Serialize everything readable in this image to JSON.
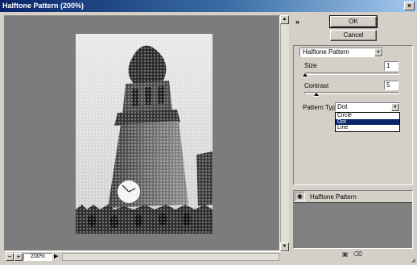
{
  "window": {
    "title": "Halftone Pattern (200%)",
    "close_glyph": "×"
  },
  "preview": {
    "zoom_out": "−",
    "zoom_in": "+",
    "zoom_level": "200%",
    "zoom_menu_glyph": "▶"
  },
  "dialog": {
    "collapse_glyph": "»",
    "ok_label": "OK",
    "cancel_label": "Cancel"
  },
  "settings": {
    "filter_name": "Halftone Pattern",
    "size_label": "Size",
    "size_value": "1",
    "size_level": 0.0,
    "contrast_label": "Contrast",
    "contrast_value": "5",
    "contrast_level": 0.05,
    "pattern_type_label": "Pattern Type:",
    "pattern_type_value": "Dot",
    "pattern_type_options": [
      "Circle",
      "Dot",
      "Line"
    ],
    "pattern_type_selected_index": 1
  },
  "layers": {
    "items": [
      {
        "name": "Halftone Pattern",
        "visible": true
      }
    ],
    "eye_glyph": "◉"
  },
  "colors": {
    "titlebar_start": "#0a246a",
    "titlebar_end": "#a6caf0",
    "dialog_bg": "#d4d0c8",
    "selection": "#0a246a"
  }
}
